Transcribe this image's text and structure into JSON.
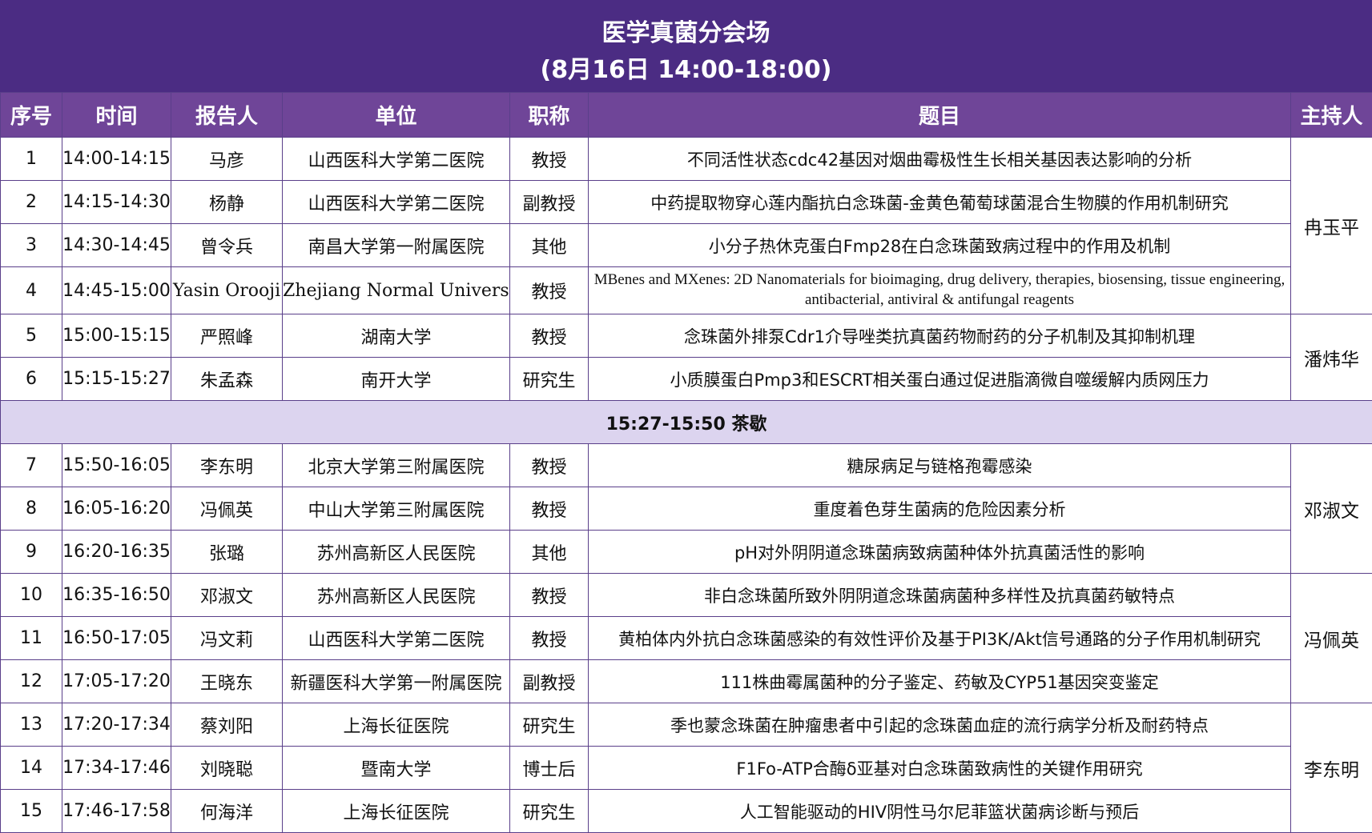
{
  "header": {
    "title": "医学真菌分会场",
    "subtitle": "(8月16日 14:00-18:00)"
  },
  "columns": [
    "序号",
    "时间",
    "报告人",
    "单位",
    "职称",
    "题目",
    "主持人"
  ],
  "rows": [
    {
      "no": "1",
      "time": "14:00-14:15",
      "speaker": "马彦",
      "org": "山西医科大学第二医院",
      "title": "教授",
      "topic": "不同活性状态cdc42基因对烟曲霉极性生长相关基因表达影响的分析"
    },
    {
      "no": "2",
      "time": "14:15-14:30",
      "speaker": "杨静",
      "org": "山西医科大学第二医院",
      "title": "副教授",
      "topic": "中药提取物穿心莲内酯抗白念珠菌-金黄色葡萄球菌混合生物膜的作用机制研究"
    },
    {
      "no": "3",
      "time": "14:30-14:45",
      "speaker": "曾令兵",
      "org": "南昌大学第一附属医院",
      "title": "其他",
      "topic": "小分子热休克蛋白Fmp28在白念珠菌致病过程中的作用及机制"
    },
    {
      "no": "4",
      "time": "14:45-15:00",
      "speaker": "Yasin Orooji",
      "org": "Zhejiang Normal University",
      "title": "教授",
      "topic": "MBenes and MXenes: 2D Nanomaterials for bioimaging, drug delivery, therapies, biosensing, tissue engineering, antibacterial, antiviral & antifungal reagents"
    },
    {
      "no": "5",
      "time": "15:00-15:15",
      "speaker": "严照峰",
      "org": "湖南大学",
      "title": "教授",
      "topic": "念珠菌外排泵Cdr1介导唑类抗真菌药物耐药的分子机制及其抑制机理"
    },
    {
      "no": "6",
      "time": "15:15-15:27",
      "speaker": "朱孟森",
      "org": "南开大学",
      "title": "研究生",
      "topic": "小质膜蛋白Pmp3和ESCRT相关蛋白通过促进脂滴微自噬缓解内质网压力"
    },
    {
      "no": "7",
      "time": "15:50-16:05",
      "speaker": "李东明",
      "org": "北京大学第三附属医院",
      "title": "教授",
      "topic": "糖尿病足与链格孢霉感染"
    },
    {
      "no": "8",
      "time": "16:05-16:20",
      "speaker": "冯佩英",
      "org": "中山大学第三附属医院",
      "title": "教授",
      "topic": "重度着色芽生菌病的危险因素分析"
    },
    {
      "no": "9",
      "time": "16:20-16:35",
      "speaker": "张璐",
      "org": "苏州高新区人民医院",
      "title": "其他",
      "topic": "pH对外阴阴道念珠菌病致病菌种体外抗真菌活性的影响"
    },
    {
      "no": "10",
      "time": "16:35-16:50",
      "speaker": "邓淑文",
      "org": "苏州高新区人民医院",
      "title": "教授",
      "topic": "非白念珠菌所致外阴阴道念珠菌病菌种多样性及抗真菌药敏特点"
    },
    {
      "no": "11",
      "time": "16:50-17:05",
      "speaker": "冯文莉",
      "org": "山西医科大学第二医院",
      "title": "教授",
      "topic": "黄柏体内外抗白念珠菌感染的有效性评价及基于PI3K/Akt信号通路的分子作用机制研究"
    },
    {
      "no": "12",
      "time": "17:05-17:20",
      "speaker": "王晓东",
      "org": "新疆医科大学第一附属医院",
      "title": "副教授",
      "topic": "111株曲霉属菌种的分子鉴定、药敏及CYP51基因突变鉴定"
    },
    {
      "no": "13",
      "time": "17:20-17:34",
      "speaker": "蔡刘阳",
      "org": "上海长征医院",
      "title": "研究生",
      "topic": "季也蒙念珠菌在肿瘤患者中引起的念珠菌血症的流行病学分析及耐药特点"
    },
    {
      "no": "14",
      "time": "17:34-17:46",
      "speaker": "刘晓聪",
      "org": "暨南大学",
      "title": "博士后",
      "topic": "F1Fo-ATP合酶δ亚基对白念珠菌致病性的关键作用研究"
    },
    {
      "no": "15",
      "time": "17:46-17:58",
      "speaker": "何海洋",
      "org": "上海长征医院",
      "title": "研究生",
      "topic": "人工智能驱动的HIV阴性马尔尼菲篮状菌病诊断与预后"
    }
  ],
  "break_row": "15:27-15:50 茶歇",
  "hosts": [
    "冉玉平",
    "潘炜华",
    "邓淑文",
    "冯佩英",
    "李东明"
  ]
}
